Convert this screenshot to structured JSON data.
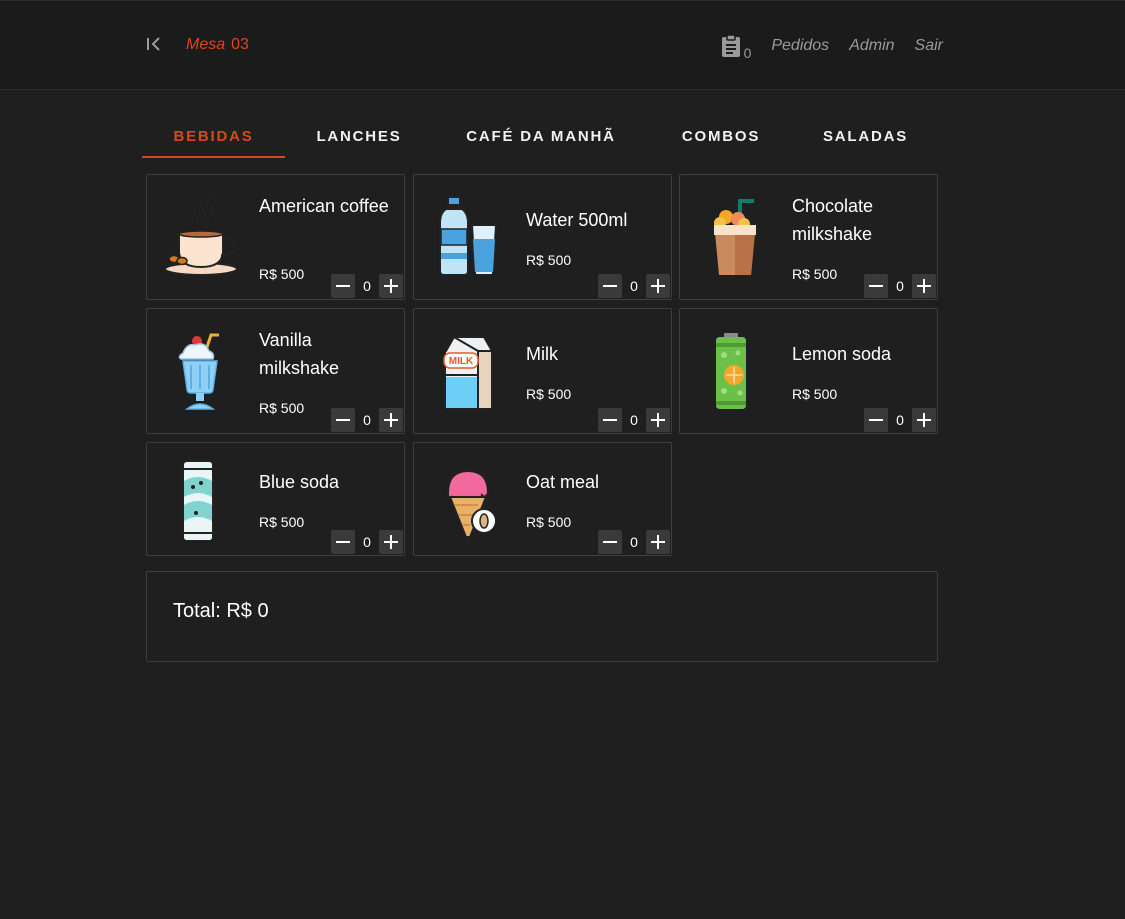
{
  "header": {
    "mesa_label": "Mesa",
    "mesa_number": "03",
    "orders_count": "0",
    "nav": [
      "Pedidos",
      "Admin",
      "Sair"
    ],
    "colors": {
      "accent": "#d9481c",
      "muted": "#9a9a9a",
      "background": "#1f1f1f"
    }
  },
  "tabs": [
    {
      "label": "BEBIDAS",
      "active": true
    },
    {
      "label": "LANCHES",
      "active": false
    },
    {
      "label": "CAFÉ DA MANHÃ",
      "active": false
    },
    {
      "label": "COMBOS",
      "active": false
    },
    {
      "label": "SALADAS",
      "active": false
    }
  ],
  "products": [
    {
      "name": "American coffee",
      "price": "R$ 500",
      "qty": "0",
      "icon": "coffee-cup-icon"
    },
    {
      "name": "Water 500ml",
      "price": "R$ 500",
      "qty": "0",
      "icon": "water-bottle-icon"
    },
    {
      "name": "Chocolate milkshake",
      "price": "R$ 500",
      "qty": "0",
      "icon": "chocolate-milkshake-icon"
    },
    {
      "name": "Vanilla milkshake",
      "price": "R$ 500",
      "qty": "0",
      "icon": "vanilla-milkshake-icon"
    },
    {
      "name": "Milk",
      "price": "R$ 500",
      "qty": "0",
      "icon": "milk-carton-icon"
    },
    {
      "name": "Lemon soda",
      "price": "R$ 500",
      "qty": "0",
      "icon": "lemon-soda-can-icon"
    },
    {
      "name": "Blue soda",
      "price": "R$ 500",
      "qty": "0",
      "icon": "blue-soda-can-icon"
    },
    {
      "name": "Oat meal",
      "price": "R$ 500",
      "qty": "0",
      "icon": "ice-cream-cone-icon"
    }
  ],
  "icon_text": {
    "milk_label": "MILK"
  },
  "total": {
    "label": "Total: R$ 0"
  }
}
